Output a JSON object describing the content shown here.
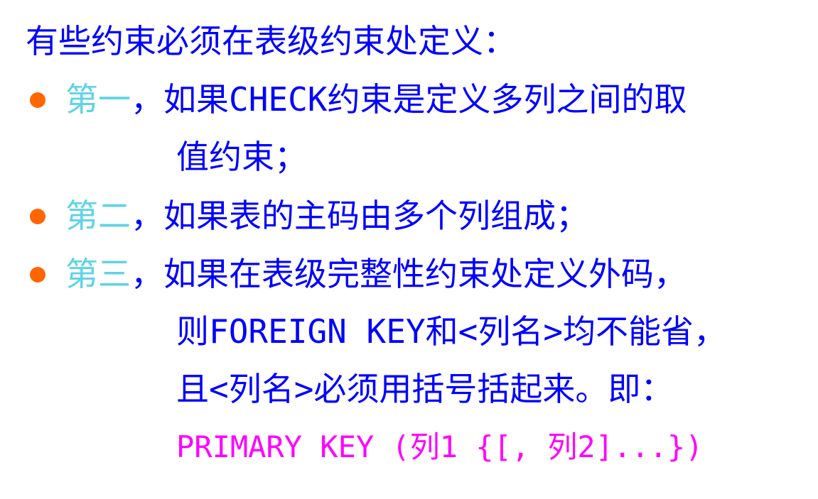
{
  "slide": {
    "intro": "有些约束必须在表级约束处定义：",
    "bullet_color": "#ff6600",
    "items": [
      {
        "ordinal": "第一",
        "lines": [
          "，如果CHECK约束是定义多列之间的取",
          "值约束；"
        ]
      },
      {
        "ordinal": "第二",
        "lines": [
          "，如果表的主码由多个列组成；"
        ]
      },
      {
        "ordinal": "第三",
        "lines": [
          "，如果在表级完整性约束处定义外码，",
          "则FOREIGN KEY和<列名>均不能省，",
          "且<列名>必须用括号括起来。即："
        ]
      }
    ],
    "code": "PRIMARY KEY (列1 {[, 列2]...})"
  }
}
